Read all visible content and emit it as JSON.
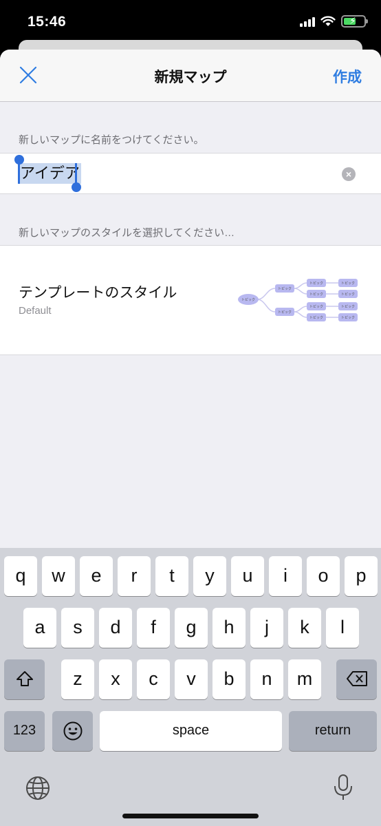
{
  "status": {
    "time": "15:46"
  },
  "nav": {
    "title": "新規マップ",
    "create_label": "作成"
  },
  "name_section": {
    "label": "新しいマップに名前をつけてください。",
    "value": "アイデア"
  },
  "style_section": {
    "label": "新しいマップのスタイルを選択してください…",
    "template_label": "テンプレートのスタイル",
    "template_value": "Default",
    "preview_topic_label": "トピック"
  },
  "keyboard": {
    "row1": [
      "q",
      "w",
      "e",
      "r",
      "t",
      "y",
      "u",
      "i",
      "o",
      "p"
    ],
    "row2": [
      "a",
      "s",
      "d",
      "f",
      "g",
      "h",
      "j",
      "k",
      "l"
    ],
    "row3": [
      "z",
      "x",
      "c",
      "v",
      "b",
      "n",
      "m"
    ],
    "numbers_label": "123",
    "space_label": "space",
    "return_label": "return"
  },
  "colors": {
    "accent": "#2f7de1",
    "selection": "#2f6fdc",
    "preview_node": "#b8b8f0",
    "preview_line": "#c9c7ee"
  }
}
